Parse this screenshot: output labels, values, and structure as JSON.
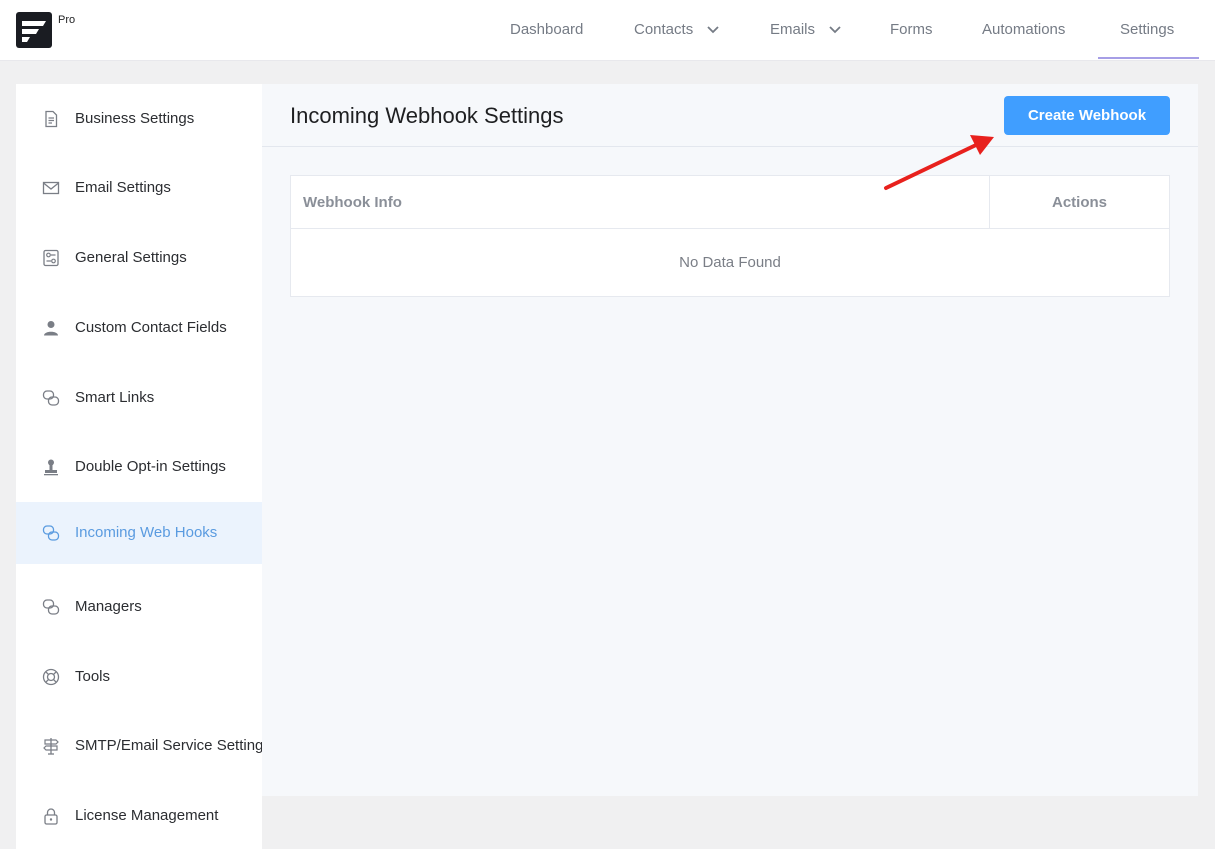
{
  "app": {
    "badge": "Pro"
  },
  "nav": {
    "items": [
      {
        "label": "Dashboard",
        "has_dropdown": false
      },
      {
        "label": "Contacts",
        "has_dropdown": true
      },
      {
        "label": "Emails",
        "has_dropdown": true
      },
      {
        "label": "Forms",
        "has_dropdown": false
      },
      {
        "label": "Automations",
        "has_dropdown": false
      },
      {
        "label": "Settings",
        "has_dropdown": false,
        "active": true
      }
    ]
  },
  "sidebar": {
    "items": [
      {
        "label": "Business Settings",
        "icon": "document-icon"
      },
      {
        "label": "Email Settings",
        "icon": "envelope-icon"
      },
      {
        "label": "General Settings",
        "icon": "settings-panel-icon"
      },
      {
        "label": "Custom Contact Fields",
        "icon": "person-icon"
      },
      {
        "label": "Smart Links",
        "icon": "link-icon"
      },
      {
        "label": "Double Opt-in Settings",
        "icon": "stamp-icon"
      },
      {
        "label": "Incoming Web Hooks",
        "icon": "link-icon",
        "active": true
      },
      {
        "label": "Managers",
        "icon": "link-icon"
      },
      {
        "label": "Tools",
        "icon": "lifebuoy-icon"
      },
      {
        "label": "SMTP/Email Service Settings",
        "icon": "signpost-icon"
      },
      {
        "label": "License Management",
        "icon": "lock-icon"
      }
    ]
  },
  "main": {
    "title": "Incoming Webhook Settings",
    "create_button": "Create Webhook",
    "table": {
      "columns": [
        "Webhook Info",
        "Actions"
      ],
      "empty_text": "No Data Found"
    }
  },
  "colors": {
    "accent": "#409eff",
    "active_link": "#5a9be0",
    "annotation_arrow": "#e8211d"
  }
}
